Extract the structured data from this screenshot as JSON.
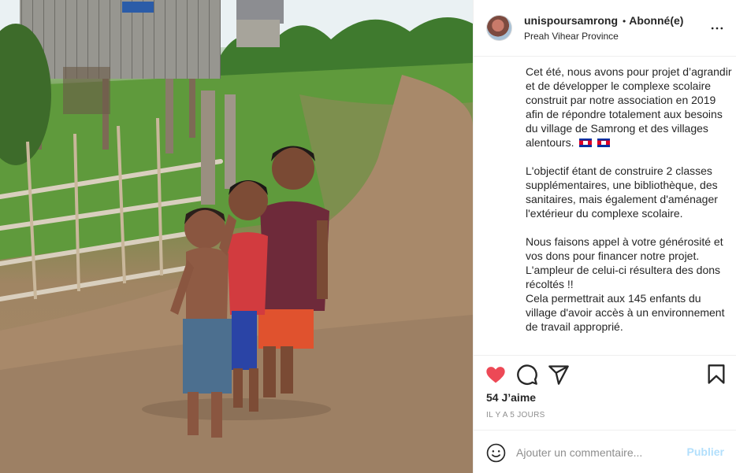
{
  "post": {
    "username": "unispoursamrong",
    "separator": "•",
    "follow_status": "Abonné(e)",
    "location": "Preah Vihear Province",
    "caption_paragraphs": [
      "Cet été, nous avons pour projet d’agrandir et de développer le complexe scolaire construit par notre association en 2019 afin de répondre totalement aux besoins du village de Samrong et des villages alentours.",
      "L'objectif étant de construire 2 classes supplémentaires, une bibliothèque, des sanitaires, mais également d'aménager l'extérieur du complexe scolaire.",
      "Nous faisons appel à votre générosité et vos dons pour financer notre projet. L'ampleur de celui-ci résultera des dons récoltés !!"
    ],
    "caption_last": "Cela permettrait aux 145 enfants du village d'avoir accès à un environnement de travail approprié.",
    "likes": "54 J’aime",
    "time_ago": "IL Y A 5 JOURS"
  },
  "comment": {
    "placeholder": "Ajouter un commentaire...",
    "post_label": "Publier"
  },
  "colors": {
    "like": "#ed4956",
    "post_disabled": "#b2dffc",
    "muted": "#8e8e8e"
  },
  "icons": {
    "more": "more-horizontal-icon",
    "like": "heart-icon",
    "comment": "comment-bubble-icon",
    "share": "paper-plane-icon",
    "save": "bookmark-icon",
    "emoji": "smiley-icon",
    "flag": "cambodia-flag-icon"
  }
}
